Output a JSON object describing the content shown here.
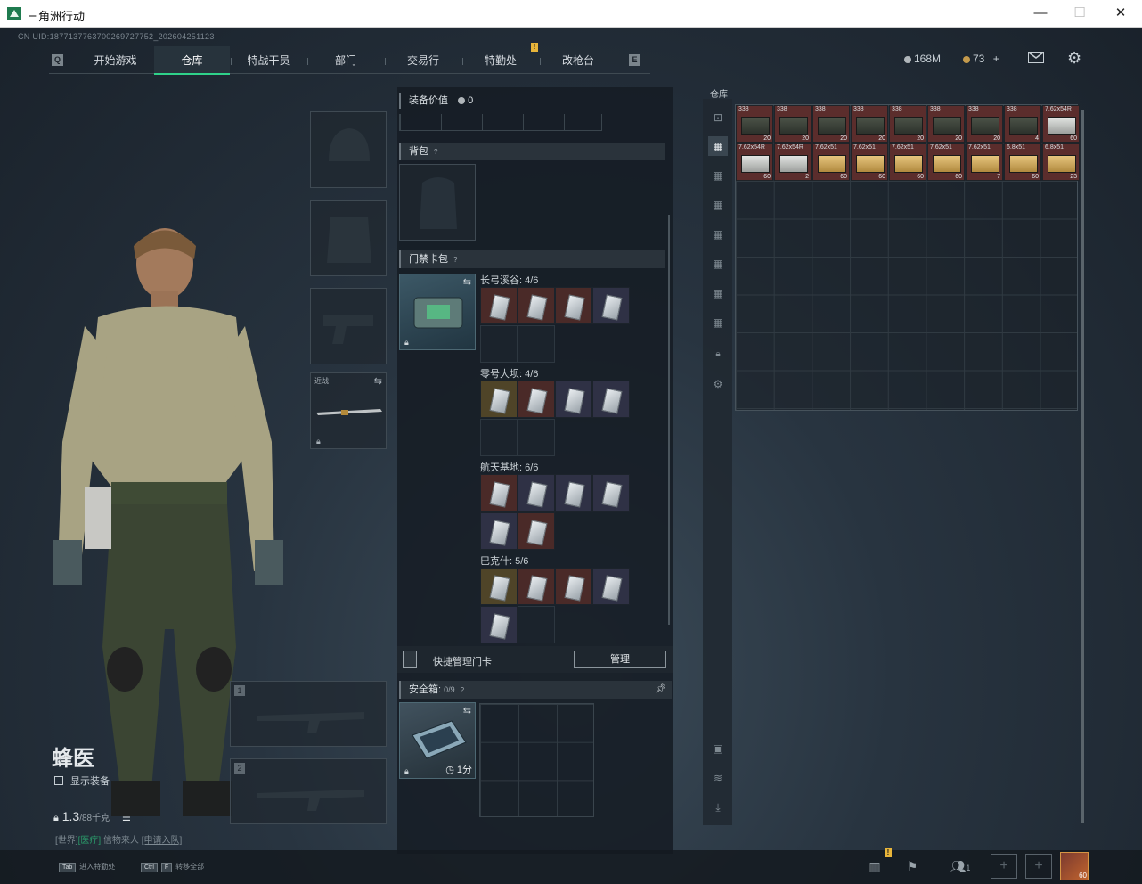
{
  "window": {
    "title": "三角洲行动",
    "minimize": "—",
    "maximize": "☐",
    "close": "✕"
  },
  "uid": "CN UID:1877137763700269727752_202604251123",
  "nav": {
    "key_left": "Q",
    "key_right": "E",
    "tabs": [
      "开始游戏",
      "仓库",
      "特战干员",
      "部门",
      "交易行",
      "特勤处",
      "改枪台"
    ],
    "active_tab": "仓库",
    "alert_badge": "!"
  },
  "currency": {
    "silver": "168M",
    "gold": "73",
    "gold_add": "+"
  },
  "character": {
    "name": "蜂医",
    "show_equipment": "显示装备",
    "weight": "1.3",
    "weight_max": "/88千克",
    "status_prefix": "[世界]",
    "status_green": "[医疗]",
    "status_text": "信物来人",
    "status_link": "[申请入队]"
  },
  "equip_slots": {
    "melee_label": "近战",
    "weapon1": "1",
    "weapon2": "2"
  },
  "middle": {
    "equip_value_label": "装备价值",
    "equip_value": "0",
    "backpack_label": "背包",
    "keycard_label": "门禁卡包",
    "keycard_groups": [
      {
        "title": "长弓溪谷: 4/6"
      },
      {
        "title": "零号大坝: 4/6"
      },
      {
        "title": "航天基地: 6/6"
      },
      {
        "title": "巴克什: 5/6"
      }
    ],
    "quick_manage_label": "快捷管理门卡",
    "manage_button": "管理",
    "safebox_label": "安全箱:",
    "safebox_count": "0/9",
    "safebox_timer": "1分"
  },
  "warehouse": {
    "label": "仓库",
    "row1": [
      {
        "cal": "338",
        "count": "20"
      },
      {
        "cal": "338",
        "count": "20"
      },
      {
        "cal": "338",
        "count": "20"
      },
      {
        "cal": "338",
        "count": "20"
      },
      {
        "cal": "338",
        "count": "20"
      },
      {
        "cal": "338",
        "count": "20"
      },
      {
        "cal": "338",
        "count": "20"
      },
      {
        "cal": "338",
        "count": "4"
      },
      {
        "cal": "7.62x54R",
        "count": "60"
      }
    ],
    "row2": [
      {
        "cal": "7.62x54R",
        "count": "60"
      },
      {
        "cal": "7.62x54R",
        "count": "2"
      },
      {
        "cal": "7.62x51",
        "count": "60"
      },
      {
        "cal": "7.62x51",
        "count": "60"
      },
      {
        "cal": "7.62x51",
        "count": "60"
      },
      {
        "cal": "7.62x51",
        "count": "60"
      },
      {
        "cal": "7.62x51",
        "count": "7"
      },
      {
        "cal": "6.8x51",
        "count": "60"
      },
      {
        "cal": "6.8x51",
        "count": "23"
      }
    ]
  },
  "bottom": {
    "hint1_key": "Tab",
    "hint1_text": "进入特勤处",
    "hint2_key1": "Ctrl",
    "hint2_key2": "F",
    "hint2_text": "转移全部",
    "friends_count": "1",
    "avatar_level": "60"
  },
  "colors": {
    "accent": "#2fd28a",
    "slot_red": "#5b2d2c",
    "slot_gold": "#5a4b2c"
  }
}
